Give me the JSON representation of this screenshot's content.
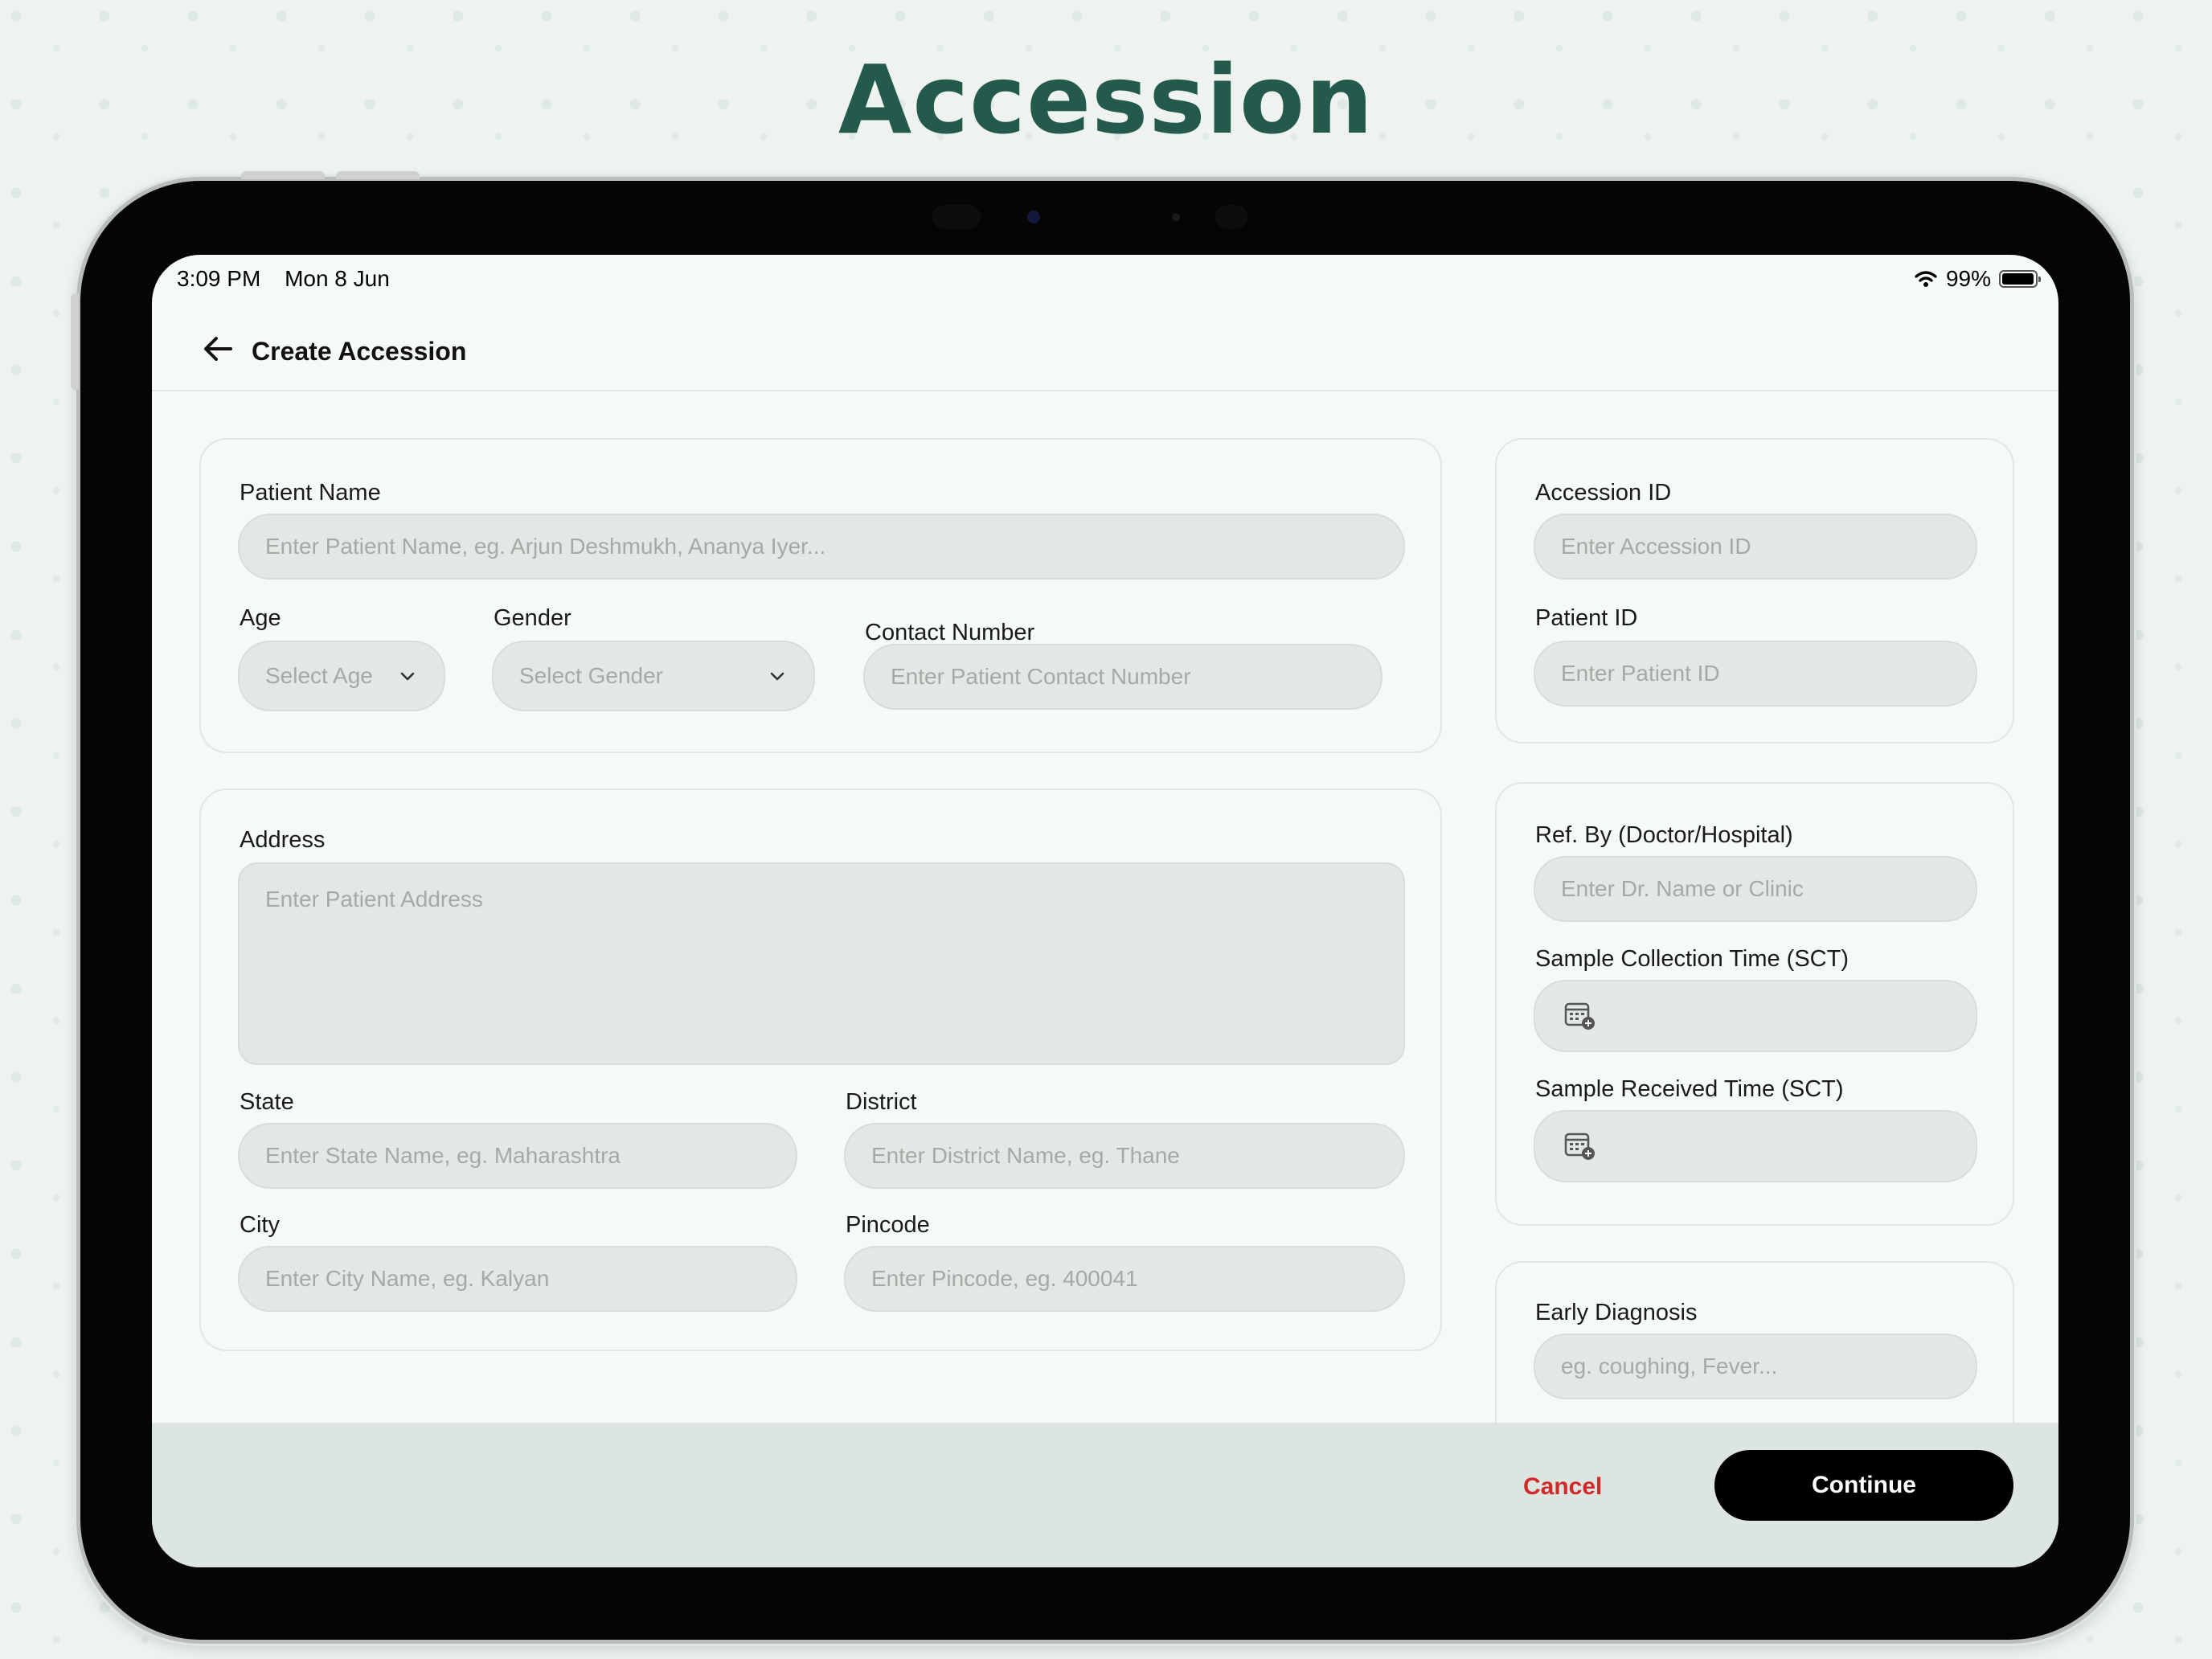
{
  "headline": "Accession",
  "status_bar": {
    "time": "3:09 PM",
    "date": "Mon 8 Jun",
    "battery": "99%"
  },
  "nav": {
    "title": "Create Accession"
  },
  "patient_card": {
    "patient_name_label": "Patient Name",
    "patient_name_placeholder": "Enter Patient Name, eg. Arjun Deshmukh, Ananya Iyer...",
    "age_label": "Age",
    "age_value": "Select Age",
    "gender_label": "Gender",
    "gender_value": "Select Gender",
    "contact_label": "Contact Number",
    "contact_placeholder": "Enter Patient Contact Number"
  },
  "address_card": {
    "address_label": "Address",
    "address_placeholder": "Enter Patient Address",
    "state_label": "State",
    "state_placeholder": "Enter State Name, eg. Maharashtra",
    "district_label": "District",
    "district_placeholder": "Enter District Name, eg. Thane",
    "city_label": "City",
    "city_placeholder": "Enter City Name, eg. Kalyan",
    "pincode_label": "Pincode",
    "pincode_placeholder": "Enter Pincode, eg. 400041"
  },
  "id_card": {
    "accession_label": "Accession ID",
    "accession_placeholder": "Enter Accession ID",
    "patient_id_label": "Patient ID",
    "patient_id_placeholder": "Enter Patient ID"
  },
  "ref_card": {
    "ref_label": "Ref. By (Doctor/Hospital)",
    "ref_placeholder": "Enter Dr. Name or Clinic",
    "collection_label": "Sample Collection Time (SCT)",
    "received_label": "Sample Received Time (SCT)"
  },
  "diagnosis_card": {
    "label": "Early Diagnosis",
    "placeholder": "eg. coughing, Fever..."
  },
  "footer": {
    "cancel_label": "Cancel",
    "continue_label": "Continue"
  },
  "colors": {
    "headline": "#235a4b",
    "cancel": "#d12a2a",
    "primary_button": "#000000"
  }
}
